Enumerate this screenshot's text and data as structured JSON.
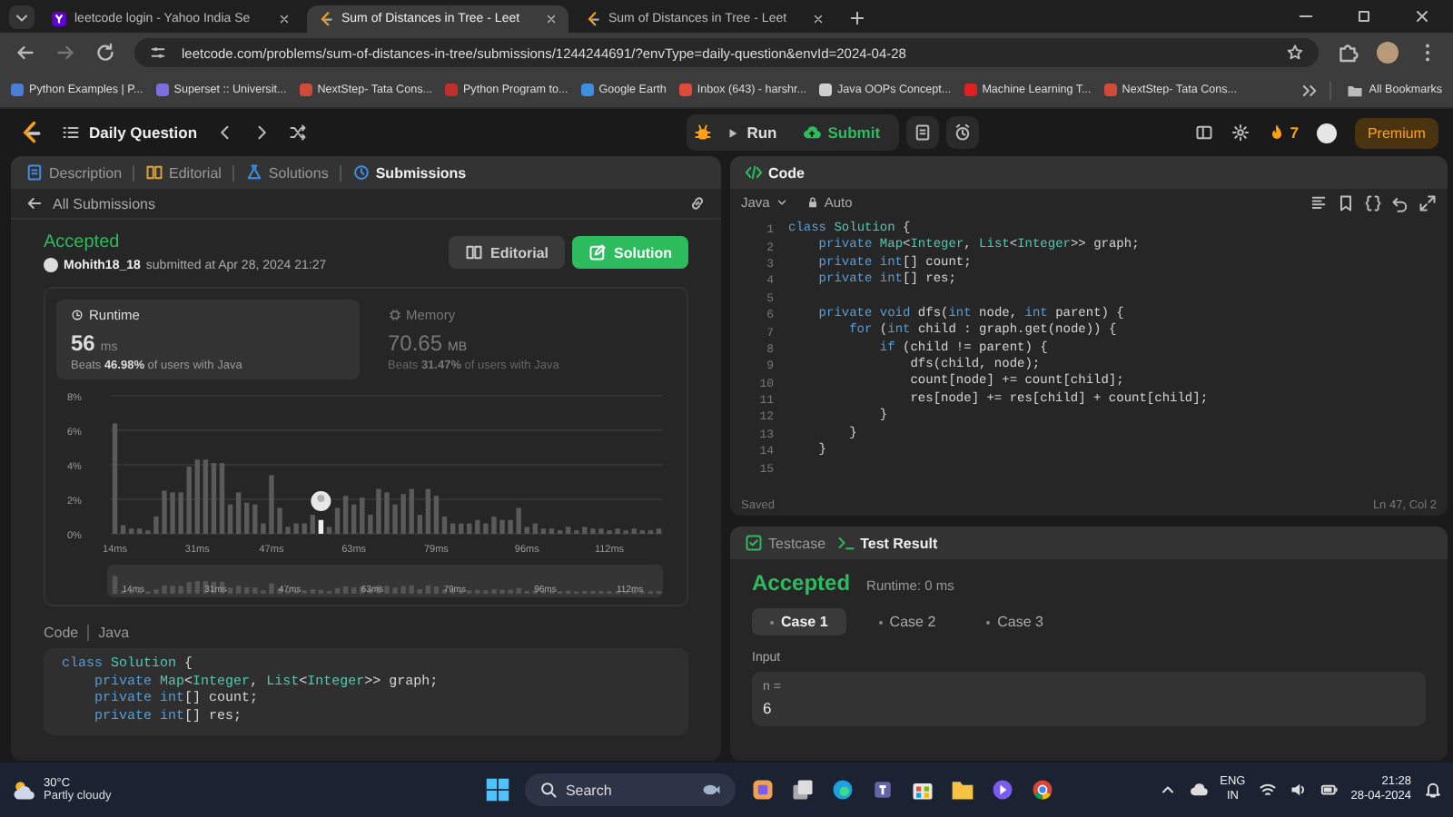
{
  "browser": {
    "tabs": [
      {
        "title": "leetcode login - Yahoo India Se",
        "selected": false
      },
      {
        "title": "Sum of Distances in Tree - Leet",
        "selected": true
      },
      {
        "title": "Sum of Distances in Tree - Leet",
        "selected": false
      }
    ],
    "address": "leetcode.com/problems/sum-of-distances-in-tree/submissions/1244244691/?envType=daily-question&envId=2024-04-28",
    "bookmarks": [
      {
        "label": "Python Examples | P...",
        "color": "#4a7fd4"
      },
      {
        "label": "Superset :: Universit...",
        "color": "#7b6fe0"
      },
      {
        "label": "NextStep- Tata Cons...",
        "color": "#d04a3a"
      },
      {
        "label": "Python Program to...",
        "color": "#c0302a"
      },
      {
        "label": "Google Earth",
        "color": "#3d8fe0"
      },
      {
        "label": "Inbox (643) - harshr...",
        "color": "#e04a3a"
      },
      {
        "label": "Java OOPs Concept...",
        "color": "#cfcfcf"
      },
      {
        "label": "Machine Learning T...",
        "color": "#e02020"
      },
      {
        "label": "NextStep- Tata Cons...",
        "color": "#d04a3a"
      }
    ],
    "all_bookmarks": "All Bookmarks"
  },
  "nav": {
    "title": "Daily Question",
    "run": "Run",
    "submit": "Submit",
    "streak": "7",
    "premium": "Premium"
  },
  "left": {
    "tabs": [
      {
        "label": "Description",
        "selected": false
      },
      {
        "label": "Editorial",
        "selected": false
      },
      {
        "label": "Solutions",
        "selected": false
      },
      {
        "label": "Submissions",
        "selected": true
      }
    ],
    "back": "All Submissions",
    "status": "Accepted",
    "user": "Mohith18_18",
    "submitted": "submitted at Apr 28, 2024 21:27",
    "buttons": [
      {
        "label": "Editorial",
        "kind": "secondary"
      },
      {
        "label": "Solution",
        "kind": "primary"
      }
    ],
    "stats": [
      {
        "label": "Runtime",
        "value": "56",
        "unit": "ms",
        "beats": "Beats **46.98%** of users with Java",
        "selected": true
      },
      {
        "label": "Memory",
        "value": "70.65",
        "unit": "MB",
        "beats": "Beats **31.47%** of users with Java",
        "selected": false
      }
    ],
    "chart_data": {
      "type": "bar",
      "grid": true,
      "ylim": [
        0,
        8
      ],
      "yticks": [
        {
          "value": 0,
          "label": "0%"
        },
        {
          "value": 2,
          "label": "2%"
        },
        {
          "value": 4,
          "label": "4%"
        },
        {
          "value": 6,
          "label": "6%"
        },
        {
          "value": 8,
          "label": "8%"
        }
      ],
      "categories": [
        "14ms",
        null,
        null,
        null,
        null,
        null,
        null,
        null,
        null,
        null,
        "31ms",
        null,
        null,
        null,
        null,
        null,
        null,
        null,
        null,
        "47ms",
        null,
        null,
        null,
        null,
        null,
        null,
        null,
        null,
        null,
        "63ms",
        null,
        null,
        null,
        null,
        null,
        null,
        null,
        null,
        null,
        "79ms",
        null,
        null,
        null,
        null,
        null,
        null,
        null,
        null,
        null,
        null,
        "96ms",
        null,
        null,
        null,
        null,
        null,
        null,
        null,
        null,
        null,
        "112ms",
        null,
        null,
        null,
        null,
        null,
        null
      ],
      "series": [
        {
          "color": "#5a5a5a",
          "values": [
            6.4,
            0.5,
            0.3,
            0.3,
            0.2,
            1.0,
            2.5,
            2.4,
            2.4,
            3.9,
            4.3,
            4.3,
            4.1,
            4.1,
            1.7,
            2.4,
            1.8,
            1.7,
            0.6,
            3.4,
            1.5,
            0.4,
            0.6,
            0.6,
            1.1,
            null,
            0.4,
            1.5,
            2.2,
            1.7,
            2.1,
            1.1,
            2.6,
            2.4,
            1.7,
            2.3,
            2.6,
            1.1,
            2.6,
            2.2,
            1.0,
            0.6,
            0.6,
            0.6,
            0.8,
            0.6,
            1.0,
            0.8,
            0.8,
            1.5,
            0.4,
            0.6,
            0.3,
            0.3,
            0.2,
            0.4,
            0.2,
            0.4,
            0.3,
            0.3,
            0.2,
            0.3,
            0.2,
            0.3,
            0.2,
            0.2,
            0.3
          ]
        },
        {
          "color": "#f0f0f0",
          "values": [
            null,
            null,
            null,
            null,
            null,
            null,
            null,
            null,
            null,
            null,
            null,
            null,
            null,
            null,
            null,
            null,
            null,
            null,
            null,
            null,
            null,
            null,
            null,
            null,
            null,
            0.8,
            null,
            null,
            null,
            null,
            null,
            null,
            null,
            null,
            null,
            null,
            null,
            null,
            null,
            null,
            null,
            null,
            null,
            null,
            null,
            null,
            null,
            null,
            null,
            null,
            null,
            null,
            null,
            null,
            null,
            null,
            null,
            null,
            null,
            null,
            null,
            null,
            null,
            null,
            null,
            null,
            null
          ]
        }
      ]
    },
    "navigator_labels": [
      "14ms",
      "31ms",
      "47ms",
      "63ms",
      "79ms",
      "96ms",
      "112ms"
    ],
    "code_label": "Code",
    "code_lang": "Java",
    "code": [
      [
        {
          "kind": "keyword",
          "text": "class "
        },
        {
          "kind": "type",
          "text": "Solution"
        },
        {
          "kind": "plain",
          "text": " {"
        }
      ],
      [
        {
          "kind": "keyword",
          "text": "    private "
        },
        {
          "kind": "type",
          "text": "Map"
        },
        {
          "kind": "plain",
          "text": "<"
        },
        {
          "kind": "type",
          "text": "Integer"
        },
        {
          "kind": "plain",
          "text": ", "
        },
        {
          "kind": "type",
          "text": "List"
        },
        {
          "kind": "plain",
          "text": "<"
        },
        {
          "kind": "type",
          "text": "Integer"
        },
        {
          "kind": "plain",
          "text": ">> graph;"
        }
      ],
      [
        {
          "kind": "keyword",
          "text": "    private int"
        },
        {
          "kind": "plain",
          "text": "[] count;"
        }
      ],
      [
        {
          "kind": "keyword",
          "text": "    private int"
        },
        {
          "kind": "plain",
          "text": "[] res;"
        }
      ]
    ]
  },
  "editor": {
    "title": "Code",
    "language": "Java",
    "mode": "Auto",
    "saved": "Saved",
    "position": "Ln 47, Col 2",
    "lines": [
      {
        "n": "1",
        "tokens": [
          {
            "kind": "keyword",
            "text": "class "
          },
          {
            "kind": "type",
            "text": "Solution"
          },
          {
            "kind": "plain",
            "text": " {"
          }
        ]
      },
      {
        "n": "2",
        "tokens": [
          {
            "kind": "keyword",
            "text": "    private "
          },
          {
            "kind": "type",
            "text": "Map"
          },
          {
            "kind": "plain",
            "text": "<"
          },
          {
            "kind": "type",
            "text": "Integer"
          },
          {
            "kind": "plain",
            "text": ", "
          },
          {
            "kind": "type",
            "text": "List"
          },
          {
            "kind": "plain",
            "text": "<"
          },
          {
            "kind": "type",
            "text": "Integer"
          },
          {
            "kind": "plain",
            "text": ">> graph;"
          }
        ]
      },
      {
        "n": "3",
        "tokens": [
          {
            "kind": "keyword",
            "text": "    private int"
          },
          {
            "kind": "plain",
            "text": "[] count;"
          }
        ]
      },
      {
        "n": "4",
        "tokens": [
          {
            "kind": "keyword",
            "text": "    private int"
          },
          {
            "kind": "plain",
            "text": "[] res;"
          }
        ]
      },
      {
        "n": "5"
      },
      {
        "n": "6",
        "tokens": [
          {
            "kind": "keyword",
            "text": "    private void "
          },
          {
            "kind": "plain",
            "text": "dfs("
          },
          {
            "kind": "keyword",
            "text": "int "
          },
          {
            "kind": "plain",
            "text": "node, "
          },
          {
            "kind": "keyword",
            "text": "int "
          },
          {
            "kind": "plain",
            "text": "parent) {"
          }
        ]
      },
      {
        "n": "7",
        "tokens": [
          {
            "kind": "keyword",
            "text": "        for "
          },
          {
            "kind": "plain",
            "text": "("
          },
          {
            "kind": "keyword",
            "text": "int "
          },
          {
            "kind": "plain",
            "text": "child : graph.get(node)) {"
          }
        ]
      },
      {
        "n": "8",
        "tokens": [
          {
            "kind": "keyword",
            "text": "            if "
          },
          {
            "kind": "plain",
            "text": "(child != parent) {"
          }
        ]
      },
      {
        "n": "9",
        "tokens": [
          {
            "kind": "plain",
            "text": "                dfs(child, node);"
          }
        ]
      },
      {
        "n": "10",
        "tokens": [
          {
            "kind": "plain",
            "text": "                count[node] += count[child];"
          }
        ]
      },
      {
        "n": "11",
        "tokens": [
          {
            "kind": "plain",
            "text": "                res[node] += res[child] + count[child];"
          }
        ]
      },
      {
        "n": "12",
        "tokens": [
          {
            "kind": "plain",
            "text": "            }"
          }
        ]
      },
      {
        "n": "13",
        "tokens": [
          {
            "kind": "plain",
            "text": "        }"
          }
        ]
      },
      {
        "n": "14",
        "tokens": [
          {
            "kind": "plain",
            "text": "    }"
          }
        ]
      },
      {
        "n": "15"
      }
    ]
  },
  "results": {
    "tabs": [
      {
        "label": "Testcase",
        "selected": false
      },
      {
        "label": "Test Result",
        "selected": true
      }
    ],
    "status": "Accepted",
    "runtime": "Runtime: 0 ms",
    "cases": [
      {
        "label": "Case 1",
        "selected": true
      },
      {
        "label": "Case 2",
        "selected": false
      },
      {
        "label": "Case 3",
        "selected": false
      }
    ],
    "input_label": "Input",
    "input_name": "n =",
    "input_value": "6"
  },
  "taskbar": {
    "temperature": "30°C",
    "weather": "Partly cloudy",
    "search_placeholder": "Search",
    "language": "ENG",
    "region": "IN",
    "time": "21:28",
    "date": "28-04-2024"
  }
}
